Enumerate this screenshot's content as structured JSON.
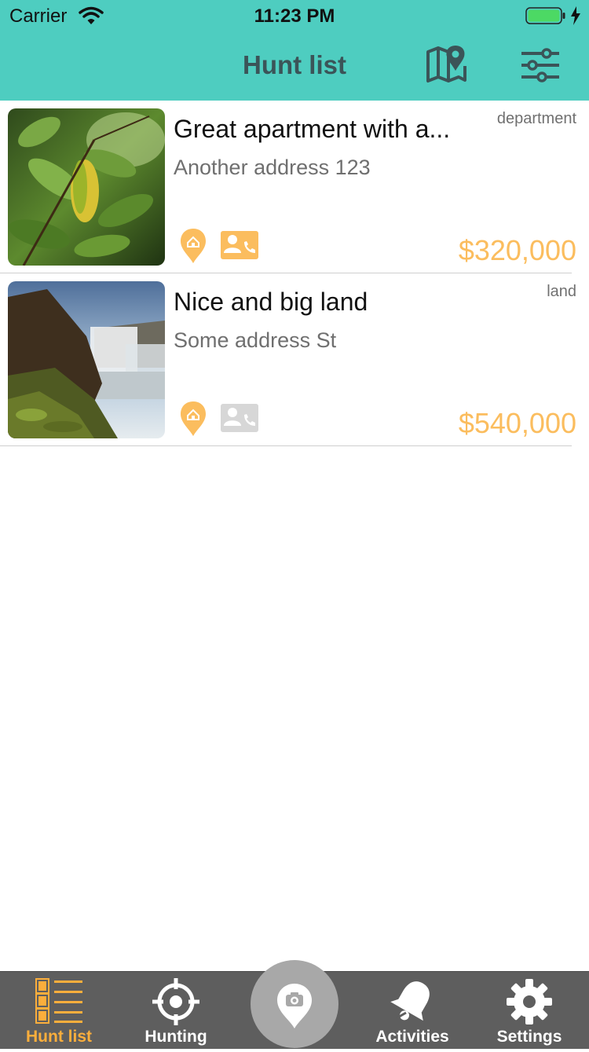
{
  "status_bar": {
    "carrier": "Carrier",
    "time": "11:23 PM"
  },
  "header": {
    "title": "Hunt list",
    "map_icon": "map-pin-icon",
    "filter_icon": "sliders-icon",
    "background_color": "#4ecdc0"
  },
  "listings": [
    {
      "title": "Great apartment with a...",
      "address": "Another address 123",
      "type": "department",
      "price": "$320,000",
      "image": "green-leaves-photo",
      "contact_active": true
    },
    {
      "title": "Nice and big land",
      "address": "Some address St",
      "type": "land",
      "price": "$540,000",
      "image": "waterfall-photo",
      "contact_active": false
    }
  ],
  "tabbar": {
    "tabs": [
      {
        "label": "Hunt list",
        "icon": "list-icon",
        "active": true
      },
      {
        "label": "Hunting",
        "icon": "crosshair-icon",
        "active": false
      },
      {
        "label": "Activities",
        "icon": "bell-icon",
        "active": false
      },
      {
        "label": "Settings",
        "icon": "gear-icon",
        "active": false
      }
    ],
    "center_button_icon": "camera-pin-icon"
  },
  "colors": {
    "accent": "#fbae3c",
    "price": "#fbbd5e",
    "tabbar": "#5e5e5e"
  }
}
